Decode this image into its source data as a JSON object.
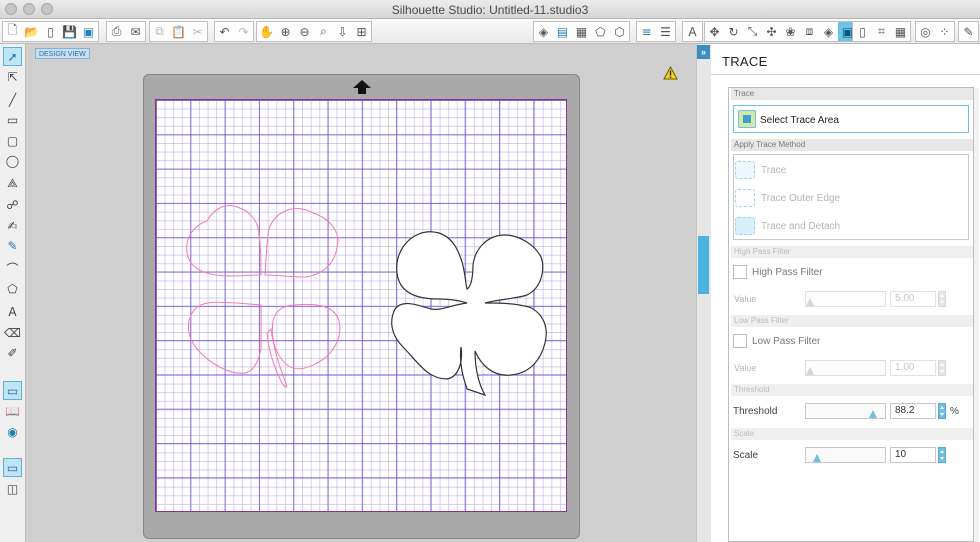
{
  "window": {
    "title": "Silhouette Studio: Untitled-11.studio3"
  },
  "toolbar": {
    "groups": [
      {
        "buttons": [
          {
            "icon": "new-file-icon",
            "glyph": "🗋",
            "state": "normal"
          },
          {
            "icon": "open-folder-icon",
            "glyph": "📂",
            "state": "normal"
          },
          {
            "icon": "open-recent-icon",
            "glyph": "▯",
            "state": "normal"
          },
          {
            "icon": "save-icon",
            "glyph": "💾",
            "state": "normal"
          },
          {
            "icon": "save-to-library-icon",
            "glyph": "▣",
            "state": "blue"
          }
        ]
      },
      {
        "buttons": [
          {
            "icon": "print-icon",
            "glyph": "⎙",
            "state": "normal"
          },
          {
            "icon": "send-to-cutter-icon",
            "glyph": "✉",
            "state": "normal"
          }
        ]
      },
      {
        "buttons": [
          {
            "icon": "copy-icon",
            "glyph": "⧉",
            "state": "dim"
          },
          {
            "icon": "paste-icon",
            "glyph": "📋",
            "state": "normal"
          },
          {
            "icon": "cut-icon",
            "glyph": "✂",
            "state": "dim"
          }
        ]
      },
      {
        "buttons": [
          {
            "icon": "undo-icon",
            "glyph": "↶",
            "state": "normal"
          },
          {
            "icon": "redo-icon",
            "glyph": "↷",
            "state": "dim"
          }
        ]
      },
      {
        "buttons": [
          {
            "icon": "pan-hand-icon",
            "glyph": "✋",
            "state": "normal"
          },
          {
            "icon": "zoom-in-icon",
            "glyph": "⊕",
            "state": "normal"
          },
          {
            "icon": "zoom-out-icon",
            "glyph": "⊖",
            "state": "normal"
          },
          {
            "icon": "zoom-select-icon",
            "glyph": "⌕",
            "state": "normal"
          },
          {
            "icon": "drag-zoom-icon",
            "glyph": "⇩",
            "state": "normal"
          },
          {
            "icon": "fit-to-page-icon",
            "glyph": "⊞",
            "state": "normal"
          }
        ]
      },
      {
        "buttons": [
          {
            "icon": "fill-color-icon",
            "glyph": "◈",
            "state": "normal"
          },
          {
            "icon": "line-color-icon",
            "glyph": "▤",
            "state": "blue"
          },
          {
            "icon": "line-style-icon",
            "glyph": "▦",
            "state": "normal"
          },
          {
            "icon": "gradient-icon",
            "glyph": "⬠",
            "state": "normal"
          },
          {
            "icon": "pattern-icon",
            "glyph": "⬡",
            "state": "normal"
          }
        ]
      },
      {
        "buttons": [
          {
            "icon": "line-style-panel-icon",
            "glyph": "≡",
            "state": "blue"
          },
          {
            "icon": "line-weight-icon",
            "glyph": "☰",
            "state": "normal"
          }
        ]
      },
      {
        "buttons": [
          {
            "icon": "text-style-icon",
            "glyph": "A",
            "state": "normal"
          }
        ]
      },
      {
        "buttons": [
          {
            "icon": "transform-icon",
            "glyph": "✥",
            "state": "normal"
          },
          {
            "icon": "rotate-icon",
            "glyph": "↻",
            "state": "normal"
          },
          {
            "icon": "scale-icon",
            "glyph": "⤡",
            "state": "normal"
          },
          {
            "icon": "move-icon",
            "glyph": "✣",
            "state": "normal"
          },
          {
            "icon": "replicate-icon",
            "glyph": "❀",
            "state": "normal"
          },
          {
            "icon": "modify-icon",
            "glyph": "⧈",
            "state": "normal"
          },
          {
            "icon": "offset-icon",
            "glyph": "◈",
            "state": "normal"
          },
          {
            "icon": "trace-icon",
            "glyph": "▣",
            "state": "active"
          }
        ]
      },
      {
        "buttons": [
          {
            "icon": "page-setup-icon",
            "glyph": "▯",
            "state": "normal"
          },
          {
            "icon": "registration-marks-icon",
            "glyph": "⌗",
            "state": "normal"
          },
          {
            "icon": "grid-settings-icon",
            "glyph": "▦",
            "state": "normal"
          }
        ]
      },
      {
        "buttons": [
          {
            "icon": "cut-settings-icon",
            "glyph": "◎",
            "state": "normal"
          },
          {
            "icon": "send-icon",
            "glyph": "⁘",
            "state": "normal"
          }
        ]
      },
      {
        "buttons": [
          {
            "icon": "sketch-icon",
            "glyph": "✎",
            "state": "normal"
          }
        ]
      }
    ]
  },
  "left_tools": [
    {
      "icon": "select-arrow-icon",
      "glyph": "➚",
      "state": "sel"
    },
    {
      "icon": "edit-points-icon",
      "glyph": "⇱",
      "state": "normal"
    },
    {
      "icon": "line-tool-icon",
      "glyph": "╱",
      "state": "normal"
    },
    {
      "icon": "rectangle-tool-icon",
      "glyph": "▭",
      "state": "normal"
    },
    {
      "icon": "rounded-rectangle-tool-icon",
      "glyph": "▢",
      "state": "normal"
    },
    {
      "icon": "ellipse-tool-icon",
      "glyph": "◯",
      "state": "normal"
    },
    {
      "icon": "polygon-tool-icon",
      "glyph": "⟁",
      "state": "normal"
    },
    {
      "icon": "curve-tool-icon",
      "glyph": "☍",
      "state": "normal"
    },
    {
      "icon": "freehand-tool-icon",
      "glyph": "✍",
      "state": "normal"
    },
    {
      "icon": "smooth-freehand-tool-icon",
      "glyph": "✎",
      "state": "blue"
    },
    {
      "icon": "arc-tool-icon",
      "glyph": "⌒",
      "state": "normal"
    },
    {
      "icon": "regular-polygon-tool-icon",
      "glyph": "⬠",
      "state": "normal"
    },
    {
      "icon": "text-tool-icon",
      "glyph": "A",
      "state": "normal"
    },
    {
      "icon": "eraser-tool-icon",
      "glyph": "⌫",
      "state": "normal"
    },
    {
      "icon": "knife-tool-icon",
      "glyph": "✐",
      "state": "normal"
    },
    {
      "icon": "design-view-icon",
      "glyph": "▭",
      "state": "sel"
    },
    {
      "icon": "library-icon",
      "glyph": "📖",
      "state": "normal"
    },
    {
      "icon": "online-store-icon",
      "glyph": "◉",
      "state": "blue"
    },
    {
      "icon": "show-cut-panel-icon",
      "glyph": "▭",
      "state": "sel"
    },
    {
      "icon": "split-view-icon",
      "glyph": "◫",
      "state": "normal"
    }
  ],
  "design_view": {
    "label": "DESIGN VIEW"
  },
  "panel": {
    "title": "TRACE",
    "sections": {
      "trace": "Trace",
      "apply_method": "Apply Trace Method",
      "high_pass": "High Pass Filter",
      "low_pass": "Low Pass Filter",
      "threshold": "Threshold",
      "scale": "Scale"
    },
    "select_trace_area": "Select Trace Area",
    "methods": [
      "Trace",
      "Trace Outer Edge",
      "Trace and Detach"
    ],
    "high_pass": {
      "checkbox_label": "High Pass Filter",
      "value_label": "Value",
      "value": "5.00",
      "level": 0.0
    },
    "low_pass": {
      "checkbox_label": "Low Pass Filter",
      "value_label": "Value",
      "value": "1.00",
      "level": 0.0
    },
    "threshold": {
      "label": "Threshold",
      "value": "88.2",
      "unit": "%",
      "level": 0.882
    },
    "scale": {
      "label": "Scale",
      "value": "10",
      "level": 0.1
    }
  },
  "colors": {
    "accent": "#6fc0e4",
    "active_tool": "#6cc3e6",
    "trace_outline": "#f07ca8",
    "shape_stroke": "#333333"
  }
}
